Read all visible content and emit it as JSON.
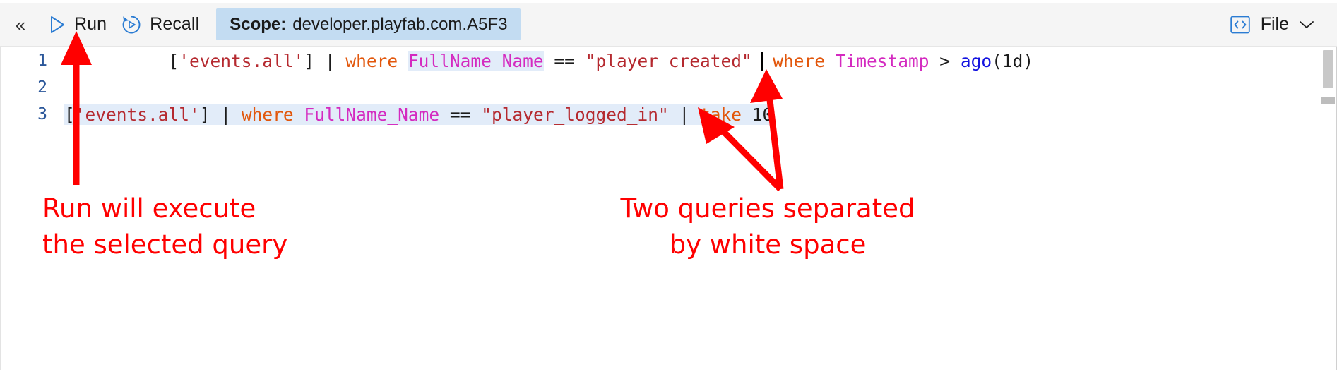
{
  "toolbar": {
    "collapse_glyph": "«",
    "collapse_name": "collapse-panel",
    "run_label": "Run",
    "recall_label": "Recall",
    "scope_key": "Scope:",
    "scope_value": "developer.playfab.com.A5F3",
    "file_label": "File"
  },
  "editor": {
    "lines": [
      {
        "number": "1",
        "selected": false,
        "text": "['events.all'] | where FullName_Name == \"player_created\" | where Timestamp > ago(1d)",
        "tokens": [
          {
            "t": "[",
            "c": "brk"
          },
          {
            "t": "'events.all'",
            "c": "str"
          },
          {
            "t": "]",
            "c": "brk"
          },
          {
            "t": " ",
            "c": "plain"
          },
          {
            "t": "|",
            "c": "pipe"
          },
          {
            "t": " ",
            "c": "plain"
          },
          {
            "t": "where",
            "c": "kw"
          },
          {
            "t": " ",
            "c": "plain"
          },
          {
            "t": "FullName_Name",
            "c": "col-hl"
          },
          {
            "t": " ",
            "c": "plain"
          },
          {
            "t": "==",
            "c": "op"
          },
          {
            "t": " ",
            "c": "plain"
          },
          {
            "t": "\"player_created\"",
            "c": "str"
          },
          {
            "t": " ",
            "c": "plain"
          },
          {
            "t": "|",
            "c": "pipe"
          },
          {
            "t": " ",
            "c": "plain"
          },
          {
            "t": "where",
            "c": "kw"
          },
          {
            "t": " ",
            "c": "plain"
          },
          {
            "t": "Timestamp",
            "c": "col"
          },
          {
            "t": " ",
            "c": "plain"
          },
          {
            "t": ">",
            "c": "op"
          },
          {
            "t": " ",
            "c": "plain"
          },
          {
            "t": "ago",
            "c": "fn"
          },
          {
            "t": "(",
            "c": "brk"
          },
          {
            "t": "1d",
            "c": "num"
          },
          {
            "t": ")",
            "c": "brk"
          }
        ]
      },
      {
        "number": "2",
        "selected": false,
        "text": "",
        "tokens": []
      },
      {
        "number": "3",
        "selected": true,
        "text": "['events.all'] | where FullName_Name == \"player_logged_in\" | take 10",
        "tokens": [
          {
            "t": "[",
            "c": "brk"
          },
          {
            "t": "'events.all'",
            "c": "str"
          },
          {
            "t": "]",
            "c": "brk"
          },
          {
            "t": " ",
            "c": "plain"
          },
          {
            "t": "|",
            "c": "pipe"
          },
          {
            "t": " ",
            "c": "plain"
          },
          {
            "t": "where",
            "c": "kw"
          },
          {
            "t": " ",
            "c": "plain"
          },
          {
            "t": "FullName_Name",
            "c": "col"
          },
          {
            "t": " ",
            "c": "plain"
          },
          {
            "t": "==",
            "c": "op"
          },
          {
            "t": " ",
            "c": "plain"
          },
          {
            "t": "\"player_logged_in\"",
            "c": "str"
          },
          {
            "t": " ",
            "c": "plain"
          },
          {
            "t": "|",
            "c": "pipe"
          },
          {
            "t": " ",
            "c": "plain"
          },
          {
            "t": "take",
            "c": "kw"
          },
          {
            "t": " ",
            "c": "plain"
          },
          {
            "t": "10",
            "c": "num"
          }
        ]
      }
    ]
  },
  "annotations": {
    "left_text": "Run will execute\nthe selected query",
    "right_text": "Two queries separated\nby white space",
    "color": "#ff0000"
  },
  "colors": {
    "toolbar_bg": "#f5f5f5",
    "scope_pill_bg": "#c3dcf2",
    "selection_bg": "#e2ecf9",
    "accent_blue": "#2b7cd3",
    "annotation_red": "#ff0000"
  }
}
